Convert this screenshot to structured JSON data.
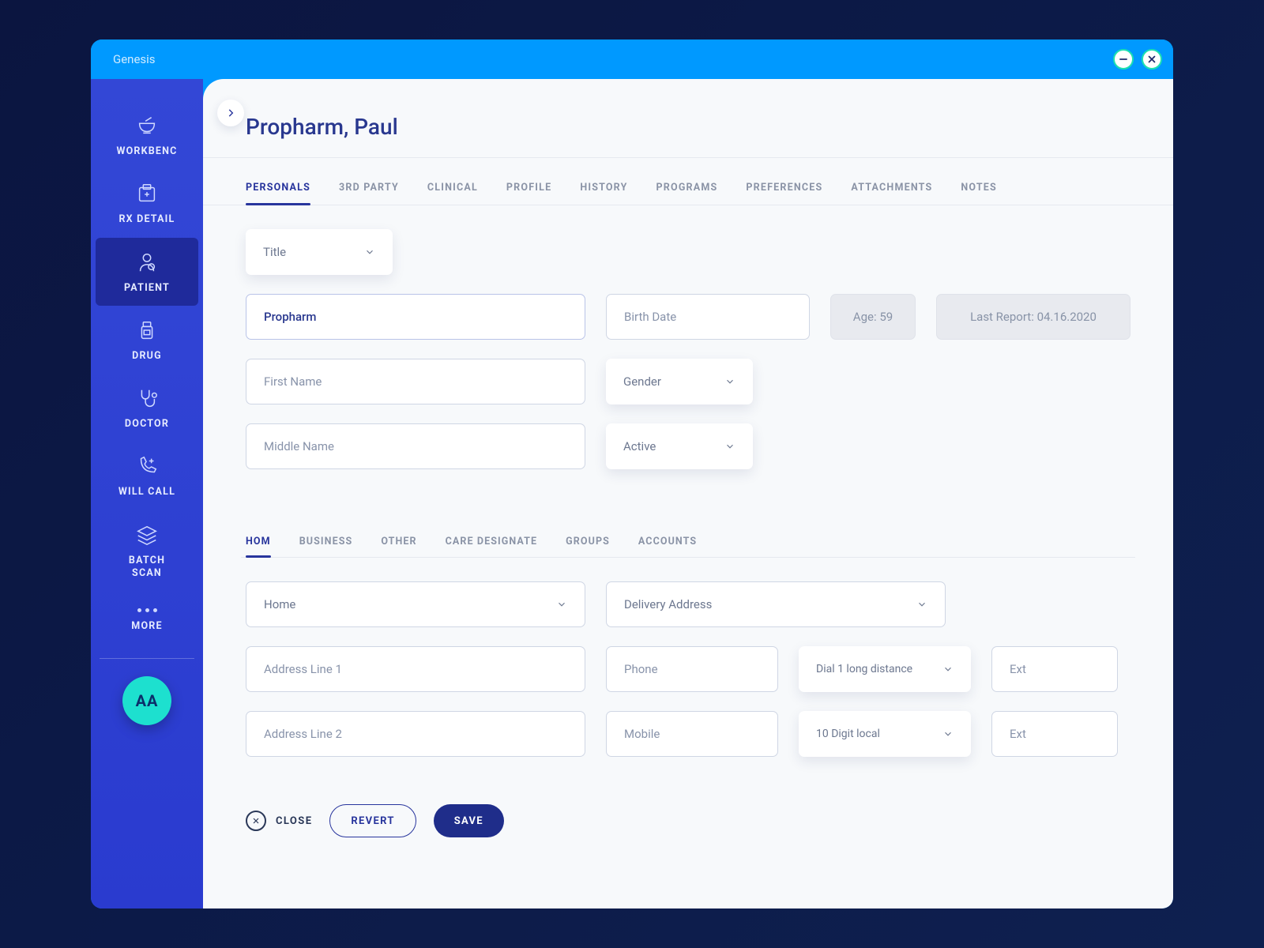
{
  "titlebar": {
    "title": "Genesis"
  },
  "sidebar": {
    "items": [
      {
        "label": "WORKBENC"
      },
      {
        "label": "RX DETAIL"
      },
      {
        "label": "PATIENT"
      },
      {
        "label": "DRUG"
      },
      {
        "label": "DOCTOR"
      },
      {
        "label": "WILL CALL"
      },
      {
        "label": "BATCH\nSCAN"
      },
      {
        "label": "MORE"
      }
    ],
    "avatar": "AA"
  },
  "header": {
    "title": "Propharm, Paul"
  },
  "tabs": [
    {
      "label": "PERSONALS"
    },
    {
      "label": "3RD PARTY"
    },
    {
      "label": "CLINICAL"
    },
    {
      "label": "PROFILE"
    },
    {
      "label": "HISTORY"
    },
    {
      "label": "PROGRAMS"
    },
    {
      "label": "PREFERENCES"
    },
    {
      "label": "ATTACHMENTS"
    },
    {
      "label": "NOTES"
    }
  ],
  "personals": {
    "title_select": "Title",
    "last_name_value": "Propharm",
    "birth_date_ph": "Birth Date",
    "age_text": "Age: 59",
    "last_report_text": "Last Report: 04.16.2020",
    "first_name_ph": "First Name",
    "gender_select": "Gender",
    "middle_name_ph": "Middle Name",
    "active_select": "Active"
  },
  "subtabs": [
    {
      "label": "HOM"
    },
    {
      "label": "BUSINESS"
    },
    {
      "label": "OTHER"
    },
    {
      "label": "CARE DESIGNATE"
    },
    {
      "label": "GROUPS"
    },
    {
      "label": "ACCOUNTS"
    }
  ],
  "address": {
    "type_select": "Home",
    "delivery_select": "Delivery Address",
    "line1_ph": "Address Line 1",
    "phone_ph": "Phone",
    "dial1_select": "Dial 1 long distance",
    "ext1_ph": "Ext",
    "line2_ph": "Address Line 2",
    "mobile_ph": "Mobile",
    "dial2_select": "10 Digit local",
    "ext2_ph": "Ext"
  },
  "actions": {
    "close": "CLOSE",
    "revert": "REVERT",
    "save": "SAVE"
  }
}
